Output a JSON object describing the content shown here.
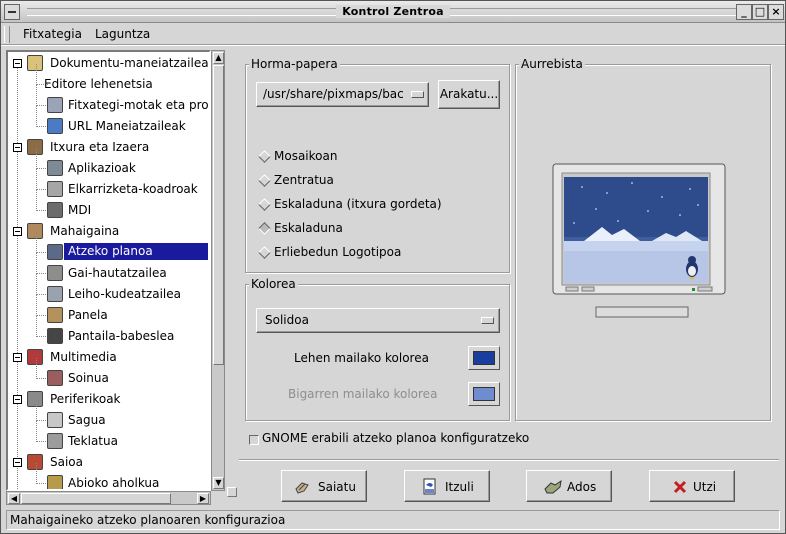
{
  "window": {
    "title": "Kontrol Zentroa"
  },
  "menu": [
    {
      "label": "Fitxategia",
      "accel": "F"
    },
    {
      "label": "Laguntza",
      "accel": "L"
    }
  ],
  "tree": {
    "groups": [
      {
        "label": "Dokumentu-maneiatzaileak",
        "icon": "documents-icon",
        "children": [
          {
            "label": "Editore lehenetsia",
            "icon": ""
          },
          {
            "label": "Fitxategi-motak eta progra",
            "icon": "file-types-icon"
          },
          {
            "label": "URL Maneiatzaileak",
            "icon": "globe-icon"
          }
        ]
      },
      {
        "label": "Itxura eta Izaera",
        "icon": "look-and-feel-icon",
        "children": [
          {
            "label": "Aplikazioak",
            "icon": "applications-icon"
          },
          {
            "label": "Elkarrizketa-koadroak",
            "icon": "dialogs-icon"
          },
          {
            "label": "MDI",
            "icon": "mdi-icon"
          }
        ]
      },
      {
        "label": "Mahaigaina",
        "icon": "desktop-icon",
        "children": [
          {
            "label": "Atzeko planoa",
            "icon": "background-icon",
            "selected": true
          },
          {
            "label": "Gai-hautatzailea",
            "icon": "theme-selector-icon"
          },
          {
            "label": "Leiho-kudeatzailea",
            "icon": "window-manager-icon"
          },
          {
            "label": "Panela",
            "icon": "panel-icon"
          },
          {
            "label": "Pantaila-babeslea",
            "icon": "screensaver-icon"
          }
        ]
      },
      {
        "label": "Multimedia",
        "icon": "multimedia-icon",
        "children": [
          {
            "label": "Soinua",
            "icon": "sound-icon"
          }
        ]
      },
      {
        "label": "Periferikoak",
        "icon": "peripherals-icon",
        "children": [
          {
            "label": "Sagua",
            "icon": "mouse-icon"
          },
          {
            "label": "Teklatua",
            "icon": "keyboard-icon"
          }
        ]
      },
      {
        "label": "Saioa",
        "icon": "session-icon",
        "children": [
          {
            "label": "Abioko aholkua",
            "icon": "startup-hint-icon"
          }
        ]
      }
    ]
  },
  "wallpaper": {
    "group_title": "Horma-papera",
    "path_value": "/usr/share/pixmaps/backg",
    "browse_label": "Arakatu...",
    "options": [
      {
        "label": "Mosaikoan",
        "checked": false
      },
      {
        "label": "Zentratua",
        "checked": false
      },
      {
        "label": "Eskaladuna (itxura gordeta)",
        "checked": false
      },
      {
        "label": "Eskaladuna",
        "checked": true
      },
      {
        "label": "Erliebedun Logotipoa",
        "checked": false
      }
    ]
  },
  "preview": {
    "group_title": "Aurrebista"
  },
  "color": {
    "group_title": "Kolorea",
    "mode_value": "Solidoa",
    "primary_label": "Lehen mailako kolorea",
    "primary_color": "#1a3e9e",
    "secondary_label": "Bigarren mailako kolorea",
    "secondary_color": "#6f8ccf"
  },
  "gnome_checkbox": {
    "label": "GNOME erabili atzeko planoa konfiguratzeko",
    "checked": false
  },
  "buttons": {
    "save": "Saiatu",
    "revert": "Itzuli",
    "ok": "Ados",
    "cancel": "Utzi"
  },
  "status": "Mahaigaineko atzeko planoaren konfigurazioa"
}
